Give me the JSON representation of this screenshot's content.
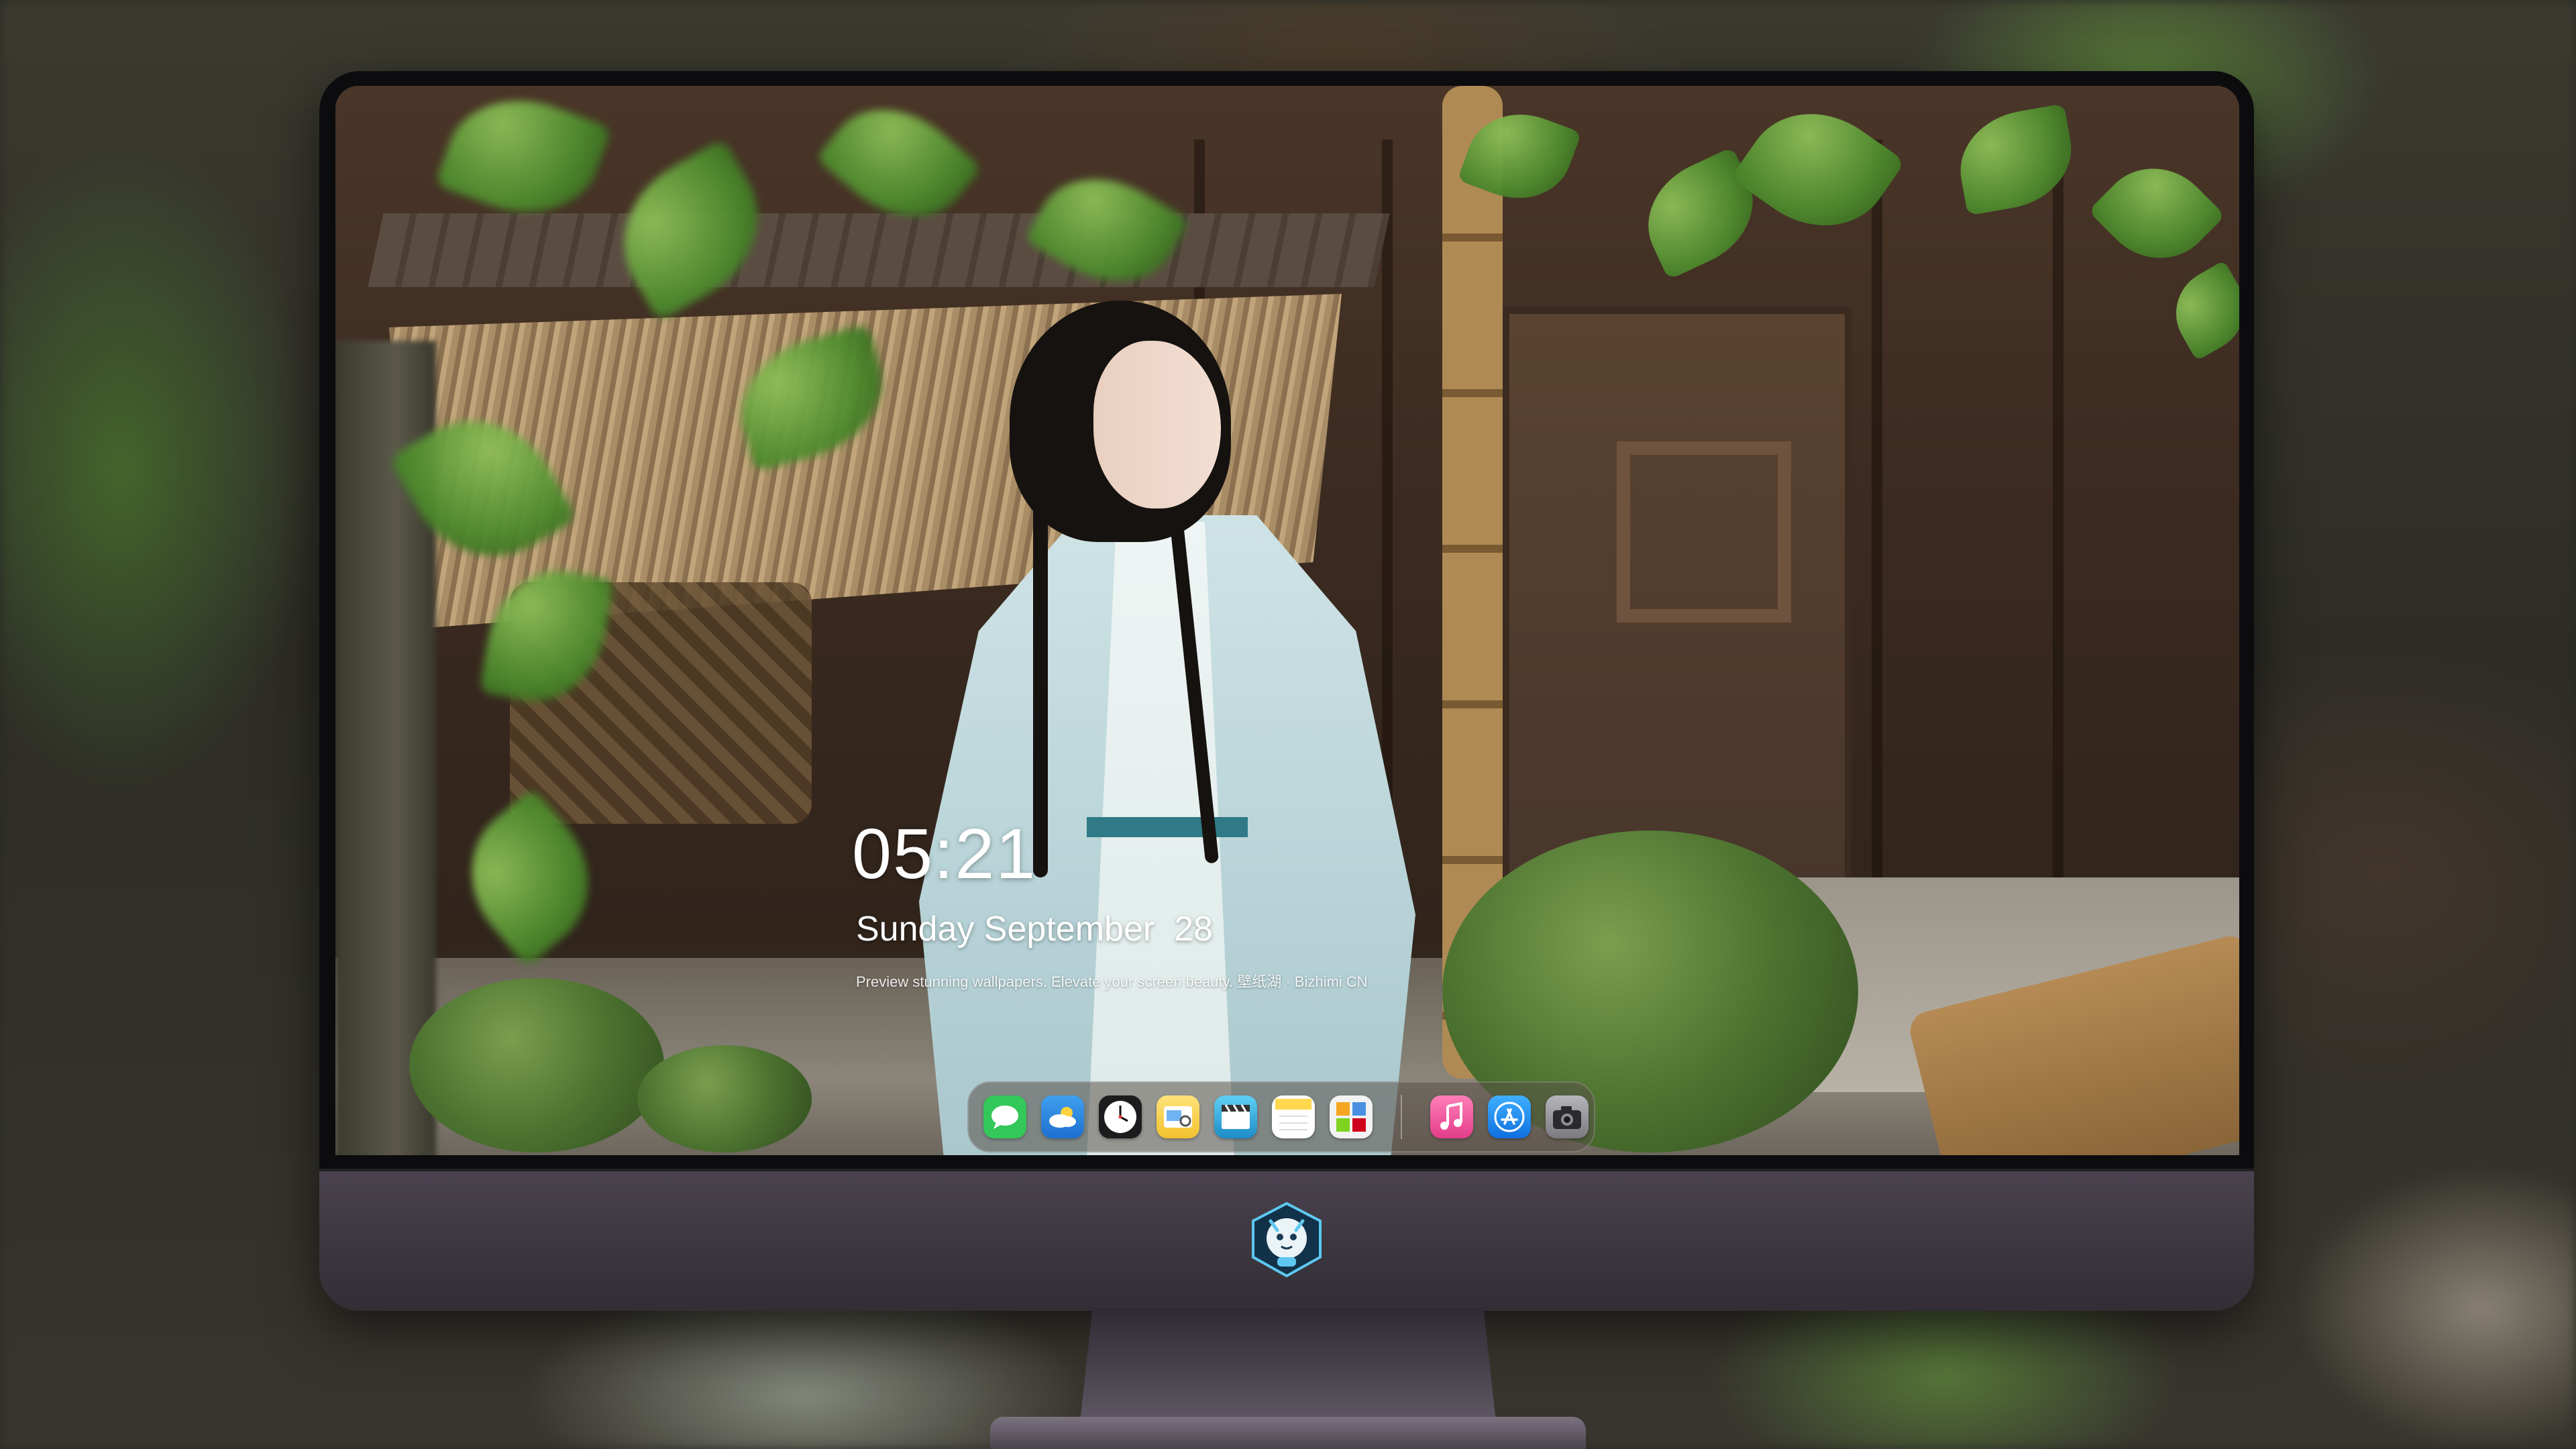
{
  "lock_screen": {
    "time": "05:21",
    "date": "Sunday September  28",
    "tagline": "Preview stunning wallpapers. Elevate your screen beauty. 壁纸湖 · Bizhimi CN"
  },
  "dock": {
    "apps": [
      {
        "icon": "messages-icon",
        "color": "#34c759"
      },
      {
        "icon": "weather-icon",
        "color": "#2f8de4"
      },
      {
        "icon": "clock-icon",
        "color": "#1c1c1e"
      },
      {
        "icon": "preview-icon",
        "color": "#f4d03f"
      },
      {
        "icon": "clips-icon",
        "color": "#2aa7d8"
      },
      {
        "icon": "notes-icon",
        "color": "#ffd84d"
      },
      {
        "icon": "photo-grid-icon",
        "color": "#e6e6e6"
      }
    ],
    "pinned": [
      {
        "icon": "music-icon",
        "color": "#f45fa0"
      },
      {
        "icon": "app-store-icon",
        "color": "#1e8cf0"
      },
      {
        "icon": "camera-icon",
        "color": "#8e8e93"
      }
    ]
  },
  "monitor": {
    "logo_icon": "brand-mascot-icon"
  }
}
